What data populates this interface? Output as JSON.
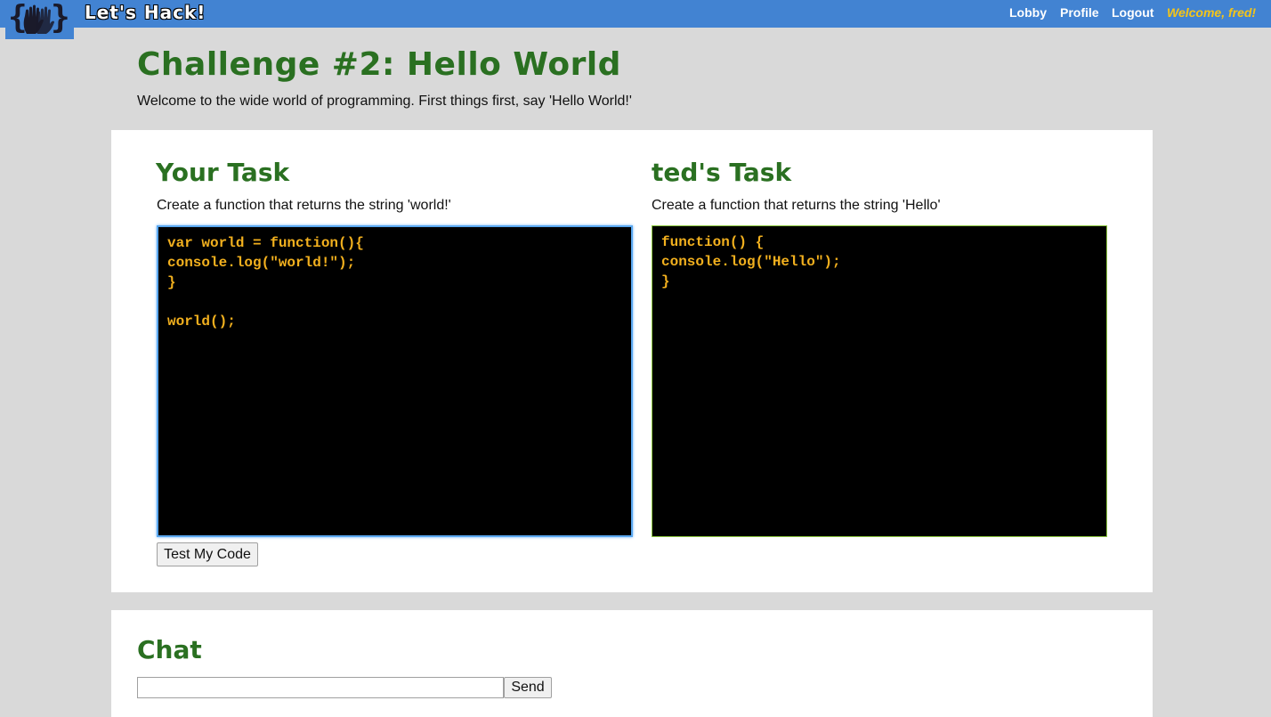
{
  "header": {
    "brand": "Let's Hack!",
    "nav": [
      {
        "label": "Lobby"
      },
      {
        "label": "Profile"
      },
      {
        "label": "Logout"
      }
    ],
    "welcome": "Welcome, fred!"
  },
  "challenge": {
    "title": "Challenge #2: Hello World",
    "description": "Welcome to the wide world of programming. First things first, say 'Hello World!'"
  },
  "my_task": {
    "title": "Your Task",
    "description": "Create a function that returns the string 'world!'",
    "code": "var world = function(){\nconsole.log(\"world!\");\n}\n\nworld();",
    "button": "Test My Code"
  },
  "partner_task": {
    "title": "ted's Task",
    "description": "Create a function that returns the string 'Hello'",
    "code": "function() {\nconsole.log(\"Hello\");\n}"
  },
  "chat": {
    "title": "Chat",
    "input_value": "",
    "send_label": "Send"
  },
  "colors": {
    "topbar": "#4283d2",
    "heading_green": "#2a7021",
    "code_text": "#f2b01e",
    "welcome": "#f5c518"
  },
  "icons": [
    "logo-hands-icon"
  ]
}
